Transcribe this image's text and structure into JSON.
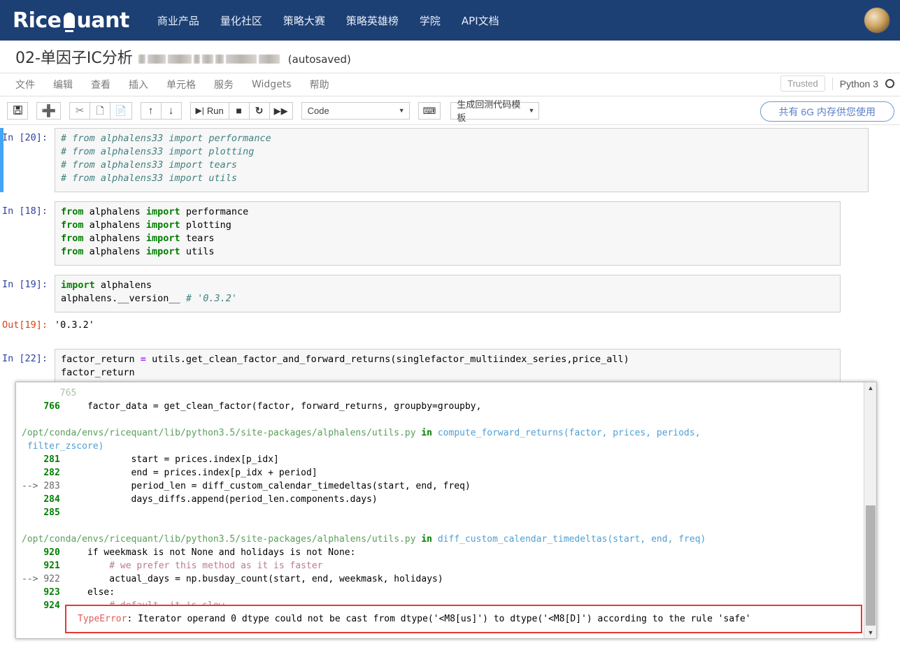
{
  "brand": {
    "logo_text": "RiceQuant",
    "nav": [
      {
        "label": "商业产品"
      },
      {
        "label": "量化社区"
      },
      {
        "label": "策略大赛"
      },
      {
        "label": "策略英雄榜"
      },
      {
        "label": "学院"
      },
      {
        "label": "API文档"
      }
    ],
    "avatar_icon": "user-avatar-icon",
    "bar_color": "#1c3f74"
  },
  "notebook": {
    "title": "02-单因子IC分析",
    "redacted_note": "blurred-filename",
    "autosaved": "(autosaved)"
  },
  "menubar": {
    "items": [
      {
        "label": "文件"
      },
      {
        "label": "编辑"
      },
      {
        "label": "查看"
      },
      {
        "label": "插入"
      },
      {
        "label": "单元格"
      },
      {
        "label": "服务"
      },
      {
        "label": "Widgets"
      },
      {
        "label": "帮助"
      }
    ],
    "trusted": "Trusted",
    "kernel": "Python 3",
    "kernel_status_icon": "kernel-idle-circle-icon"
  },
  "toolbar": {
    "save_icon": "save-disk-icon",
    "insert_icon": "plus-icon",
    "cut_icon": "scissors-icon",
    "copy_icon": "copy-icon",
    "paste_icon": "paste-icon",
    "move_up_icon": "arrow-up-icon",
    "move_down_icon": "arrow-down-icon",
    "run_label": "Run",
    "run_icon": "run-step-icon",
    "stop_icon": "stop-square-icon",
    "restart_icon": "restart-circle-icon",
    "restart_run_all_icon": "fast-forward-icon",
    "cell_type": "Code",
    "cell_type_caret": "chevron-down-icon",
    "command_palette_icon": "keyboard-icon",
    "template_label": "生成回测代码模板",
    "template_caret": "chevron-down-icon",
    "memory_notice": "共有 6G 内存供您使用",
    "memory_notice_color": "#5b7fc7"
  },
  "cells": [
    {
      "prompt": "In [20]:",
      "selected": true,
      "lines": [
        "# from alphalens33 import performance",
        "# from alphalens33 import plotting",
        "# from alphalens33 import tears",
        "# from alphalens33 import utils"
      ]
    },
    {
      "prompt": "In [18]:",
      "selected": false,
      "lines": [
        "from alphalens import performance",
        "from alphalens import plotting",
        "from alphalens import tears",
        "from alphalens import utils"
      ]
    },
    {
      "prompt": "In [19]:",
      "selected": false,
      "lines": [
        "import alphalens",
        "alphalens.__version__ # '0.3.2'"
      ],
      "output_prompt": "Out[19]:",
      "output": "'0.3.2'"
    },
    {
      "prompt": "In [22]:",
      "selected": false,
      "lines": [
        "factor_return = utils.get_clean_factor_and_forward_returns(singlefactor_multiindex_series,price_all)",
        "factor_return"
      ]
    }
  ],
  "traceback": {
    "frames": [
      {
        "line_no": "766",
        "code": "factor_data = get_clean_factor(factor, forward_returns, groupby=groupby,"
      }
    ],
    "frame1_path": "/opt/conda/envs/ricequant/lib/python3.5/site-packages/alphalens/utils.py",
    "frame1_in": "in",
    "frame1_func": "compute_forward_returns(factor, prices, periods,",
    "frame1_func_cont": "filter_zscore)",
    "frame1_lines": [
      {
        "marker": "",
        "no": "281",
        "code": "start = prices.index[p_idx]"
      },
      {
        "marker": "",
        "no": "282",
        "code": "end = prices.index[p_idx + period]"
      },
      {
        "marker": "-->",
        "no": "283",
        "code": "period_len = diff_custom_calendar_timedeltas(start, end, freq)"
      },
      {
        "marker": "",
        "no": "284",
        "code": "days_diffs.append(period_len.components.days)"
      },
      {
        "marker": "",
        "no": "285",
        "code": ""
      }
    ],
    "frame2_path": "/opt/conda/envs/ricequant/lib/python3.5/site-packages/alphalens/utils.py",
    "frame2_in": "in",
    "frame2_func": "diff_custom_calendar_timedeltas(start, end, freq)",
    "frame2_lines": [
      {
        "marker": "",
        "no": "920",
        "code": "if weekmask is not None and holidays is not None:"
      },
      {
        "marker": "",
        "no": "921",
        "code": "# we prefer this method as it is faster"
      },
      {
        "marker": "-->",
        "no": "922",
        "code": "actual_days = np.busday_count(start, end, weekmask, holidays)"
      },
      {
        "marker": "",
        "no": "923",
        "code": "else:"
      },
      {
        "marker": "",
        "no": "924",
        "code": "# default, it is slow"
      }
    ],
    "error_type": "TypeError",
    "error_message": ": Iterator operand 0 dtype could not be cast from dtype('<M8[us]') to dtype('<M8[D]') according to the rule 'safe'",
    "error_border_color": "#e53935",
    "scrollbar_up_icon": "triangle-up-icon",
    "scrollbar_down_icon": "triangle-down-icon"
  }
}
